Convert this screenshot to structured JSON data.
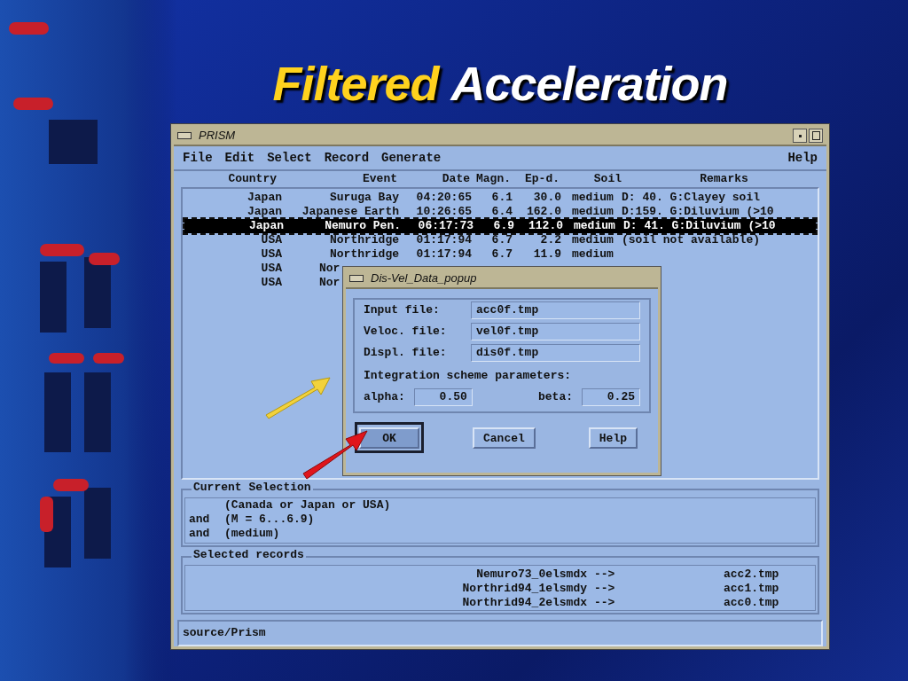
{
  "slide": {
    "title_highlight": "Filtered",
    "title": "Acceleration"
  },
  "window": {
    "title": "PRISM",
    "menu": [
      {
        "label": "File"
      },
      {
        "label": "Edit"
      },
      {
        "label": "Select"
      },
      {
        "label": "Record"
      },
      {
        "label": "Generate"
      }
    ],
    "help_menu": "Help",
    "list": {
      "columns": [
        "Country",
        "Event",
        "Date",
        "Magn.",
        "Ep-d.",
        "Soil",
        "Remarks"
      ],
      "rows": [
        {
          "selected": false,
          "cells": [
            "Japan",
            "Suruga Bay",
            "04:20:65",
            "6.1",
            "30.0",
            "medium",
            "D: 40. G:Clayey soil"
          ]
        },
        {
          "selected": false,
          "cells": [
            "Japan",
            "Japanese Earth",
            "10:26:65",
            "6.4",
            "162.0",
            "medium",
            "D:159. G:Diluvium (>10"
          ]
        },
        {
          "selected": true,
          "cells": [
            "Japan",
            "Nemuro Pen.",
            "06:17:73",
            "6.9",
            "112.0",
            "medium",
            "D: 41. G:Diluvium (>10"
          ]
        },
        {
          "selected": false,
          "cells": [
            "USA",
            "Northridge",
            "01:17:94",
            "6.7",
            "2.2",
            "medium",
            "(soil not available)"
          ]
        },
        {
          "selected": false,
          "cells": [
            "USA",
            "Northridge",
            "01:17:94",
            "6.7",
            "11.9",
            "medium"
          ]
        },
        {
          "selected": false,
          "cells": [
            "USA",
            "Nor"
          ]
        },
        {
          "selected": false,
          "cells": [
            "USA",
            "Nor"
          ]
        }
      ]
    },
    "current_selection": {
      "label": "Current Selection",
      "lines": [
        {
          "term": "(Canada or Japan or USA)"
        },
        {
          "operator": "and",
          "term": "(M = 6...6.9)"
        },
        {
          "operator": "and",
          "term": "(medium)"
        }
      ]
    },
    "selected_records": {
      "label": "Selected records",
      "rows": [
        {
          "source": "Nemuro73_0elsmdx",
          "arrow": "-->",
          "target": "acc2.tmp"
        },
        {
          "source": "Northrid94_1elsmdy",
          "arrow": "-->",
          "target": "acc1.tmp"
        },
        {
          "source": "Northrid94_2elsmdx",
          "arrow": "-->",
          "target": "acc0.tmp"
        }
      ]
    },
    "status_bar": "source/Prism"
  },
  "popup": {
    "title": "Dis-Vel_Data_popup",
    "fields": [
      {
        "label": "Input file:",
        "value": "acc0f.tmp"
      },
      {
        "label": "Veloc. file:",
        "value": "vel0f.tmp"
      },
      {
        "label": "Displ. file:",
        "value": "dis0f.tmp"
      }
    ],
    "section": "Integration scheme parameters:",
    "params": [
      {
        "label": "alpha:",
        "value": "0.50"
      },
      {
        "label": "beta:",
        "value": "0.25"
      }
    ],
    "buttons": [
      {
        "label": "OK",
        "default": true
      },
      {
        "label": "Cancel",
        "default": false
      },
      {
        "label": "Help",
        "default": false
      }
    ]
  }
}
